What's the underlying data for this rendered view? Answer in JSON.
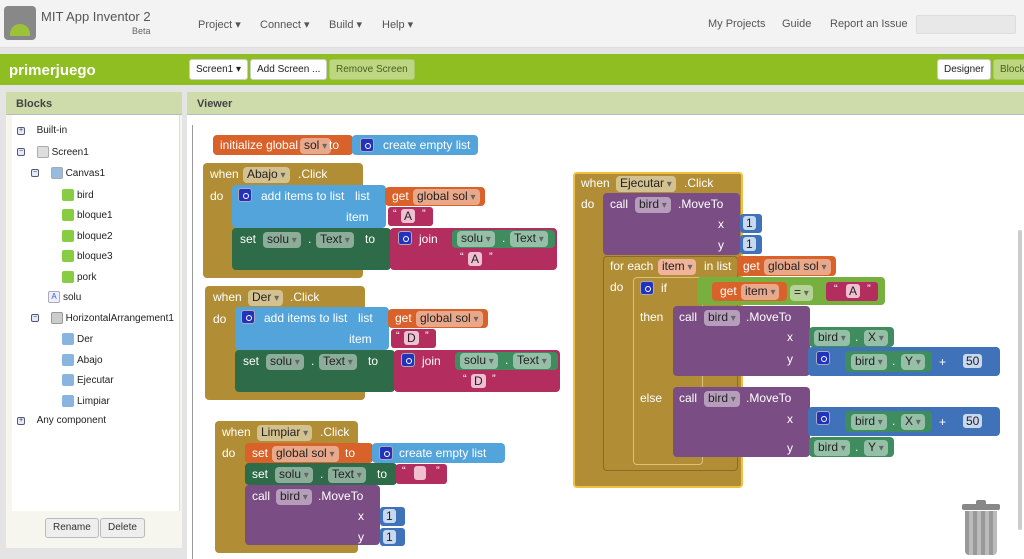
{
  "app": {
    "title": "MIT App Inventor 2",
    "subtitle": "Beta",
    "menus": [
      "Project",
      "Connect",
      "Build",
      "Help"
    ],
    "right_links": [
      "My Projects",
      "Guide",
      "Report an Issue"
    ],
    "account_select": ""
  },
  "project": {
    "name": "primerjuego",
    "screen_select": "Screen1",
    "add_screen": "Add Screen ...",
    "remove_screen": "Remove Screen",
    "designer": "Designer",
    "blocks": "Blocks"
  },
  "blocks_panel": {
    "title": "Blocks",
    "tree": [
      {
        "label": "Built-in",
        "toggle": "+"
      },
      {
        "label": "Screen1",
        "toggle": "−"
      },
      {
        "label": "Canvas1",
        "toggle": "−"
      },
      {
        "label": "bird"
      },
      {
        "label": "bloque1"
      },
      {
        "label": "bloque2"
      },
      {
        "label": "bloque3"
      },
      {
        "label": "pork"
      },
      {
        "label": "solu"
      },
      {
        "label": "HorizontalArrangement1",
        "toggle": "−"
      },
      {
        "label": "Der"
      },
      {
        "label": "Abajo"
      },
      {
        "label": "Ejecutar"
      },
      {
        "label": "Limpiar"
      },
      {
        "label": "Any component",
        "toggle": "+"
      }
    ],
    "rename": "Rename",
    "delete": "Delete"
  },
  "viewer": {
    "title": "Viewer"
  },
  "kw": {
    "init_global": "initialize global",
    "to": "to",
    "create_empty": "create empty list",
    "when": "when",
    "click": ".Click",
    "do": "do",
    "add_items": "add items to list",
    "list": "list",
    "item": "item",
    "get": "get",
    "set": "set",
    "dot": ".",
    "join": "join",
    "call": "call",
    "moveto": ".MoveTo",
    "x": "x",
    "y": "y",
    "for_each": "for each",
    "in_list": "in list",
    "if": "if",
    "then": "then",
    "else": "else",
    "eq": "=",
    "plus": "+"
  },
  "names": {
    "sol": "sol",
    "global_sol": "global sol",
    "solu": "solu",
    "text": "Text",
    "bird": "bird",
    "X": "X",
    "Y": "Y",
    "item": "item",
    "abajo": "Abajo",
    "der": "Der",
    "limpiar": "Limpiar",
    "ejecutar": "Ejecutar"
  },
  "values": {
    "A": "A",
    "D": "D",
    "empty": "",
    "one": "1",
    "fifty": "50"
  },
  "colors": {
    "event": "#b18e35",
    "variable": "#d9622b",
    "list": "#54a4dc",
    "text": "#b32d5e",
    "component_set": "#2e6b48",
    "component_get": "#3f8d5f",
    "procedure_call": "#7a4d84",
    "math": "#3f72b8",
    "logic": "#78b040",
    "brand_green": "#8fbe22"
  },
  "icons": [
    "android-logo-icon",
    "gear-mutator-icon",
    "trash-can-icon"
  ]
}
